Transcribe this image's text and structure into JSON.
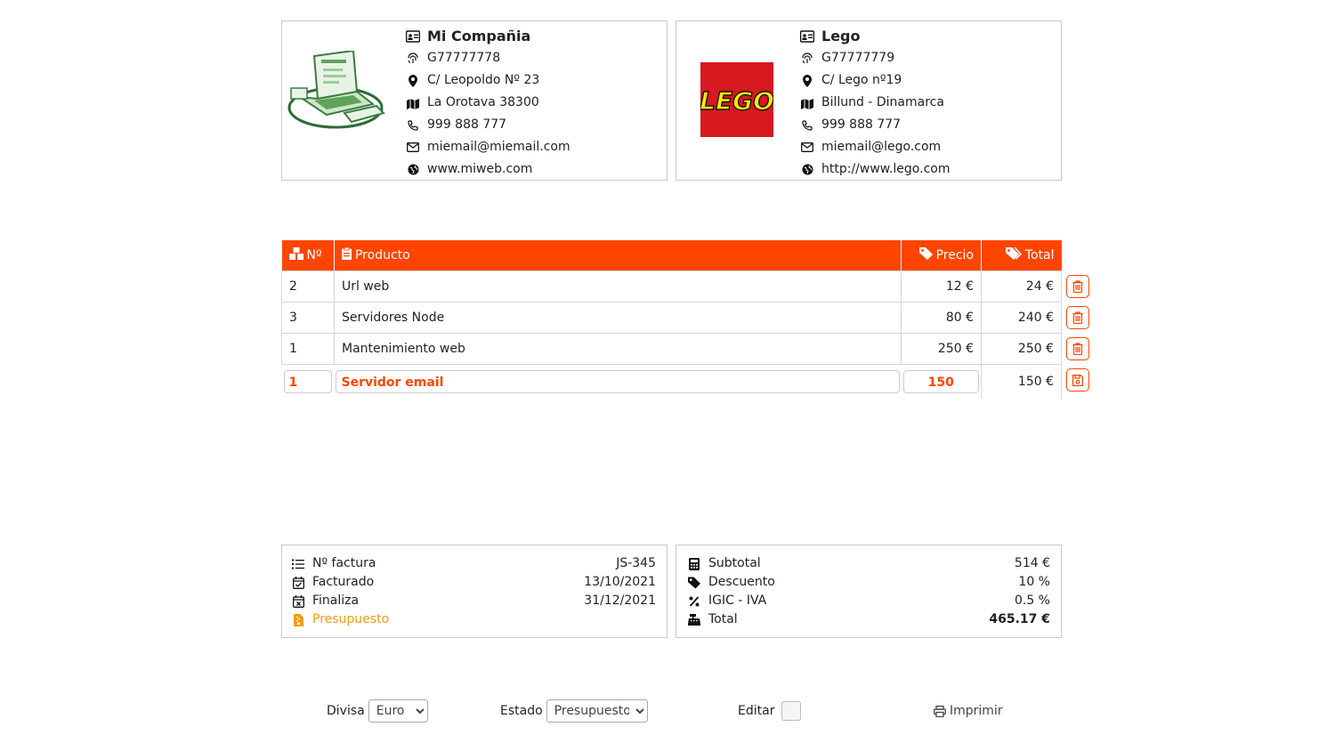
{
  "company": {
    "name": "Mi Compañia",
    "cif": "G77777778",
    "address": "C/ Leopoldo Nº 23",
    "city": "La Orotava 38300",
    "phone": "999 888 777",
    "email": "miemail@miemail.com",
    "web": "www.miweb.com"
  },
  "client": {
    "name": "Lego",
    "logo_text": "LEGO",
    "cif": "G77777779",
    "address": "C/ Lego nº19",
    "city": "Billund - Dinamarca",
    "phone": "999 888 777",
    "email": "miemail@lego.com",
    "web": "http://www.lego.com"
  },
  "table": {
    "headers": {
      "num": "Nº",
      "product": "Producto",
      "price": "Precio",
      "total": "Total"
    },
    "rows": [
      {
        "qty": "2",
        "product": "Url web",
        "price": "12 €",
        "total": "24 €"
      },
      {
        "qty": "3",
        "product": "Servidores Node",
        "price": "80 €",
        "total": "240 €"
      },
      {
        "qty": "1",
        "product": "Mantenimiento web",
        "price": "250 €",
        "total": "250 €"
      }
    ],
    "edit_row": {
      "qty": "1",
      "product": "Servidor email",
      "price": "150",
      "total": "150 €"
    }
  },
  "invoice": {
    "number_label": "Nº factura",
    "number": "JS-345",
    "billed_label": "Facturado",
    "billed": "13/10/2021",
    "ends_label": "Finaliza",
    "ends": "31/12/2021",
    "status_label": "Presupuesto"
  },
  "totals": {
    "subtotal_label": "Subtotal",
    "subtotal": "514 €",
    "discount_label": "Descuento",
    "discount": "10 %",
    "tax_label": "IGIC - IVA",
    "tax": "0.5 %",
    "total_label": "Total",
    "total": "465.17 €"
  },
  "controls": {
    "currency_label": "Divisa",
    "currency_value": "Euro",
    "status_label": "Estado",
    "status_value": "Presupuesto",
    "edit_label": "Editar",
    "print_label": "Imprimir"
  },
  "colors": {
    "accent": "#ff4500",
    "status": "#f39c12",
    "lego_red": "#d71920",
    "lego_yellow": "#ffe600"
  },
  "icons": [
    "id-card-icon",
    "fingerprint-icon",
    "map-pin-icon",
    "map-icon",
    "phone-icon",
    "mail-icon",
    "globe-icon",
    "trash-icon",
    "save-icon",
    "print-icon"
  ]
}
